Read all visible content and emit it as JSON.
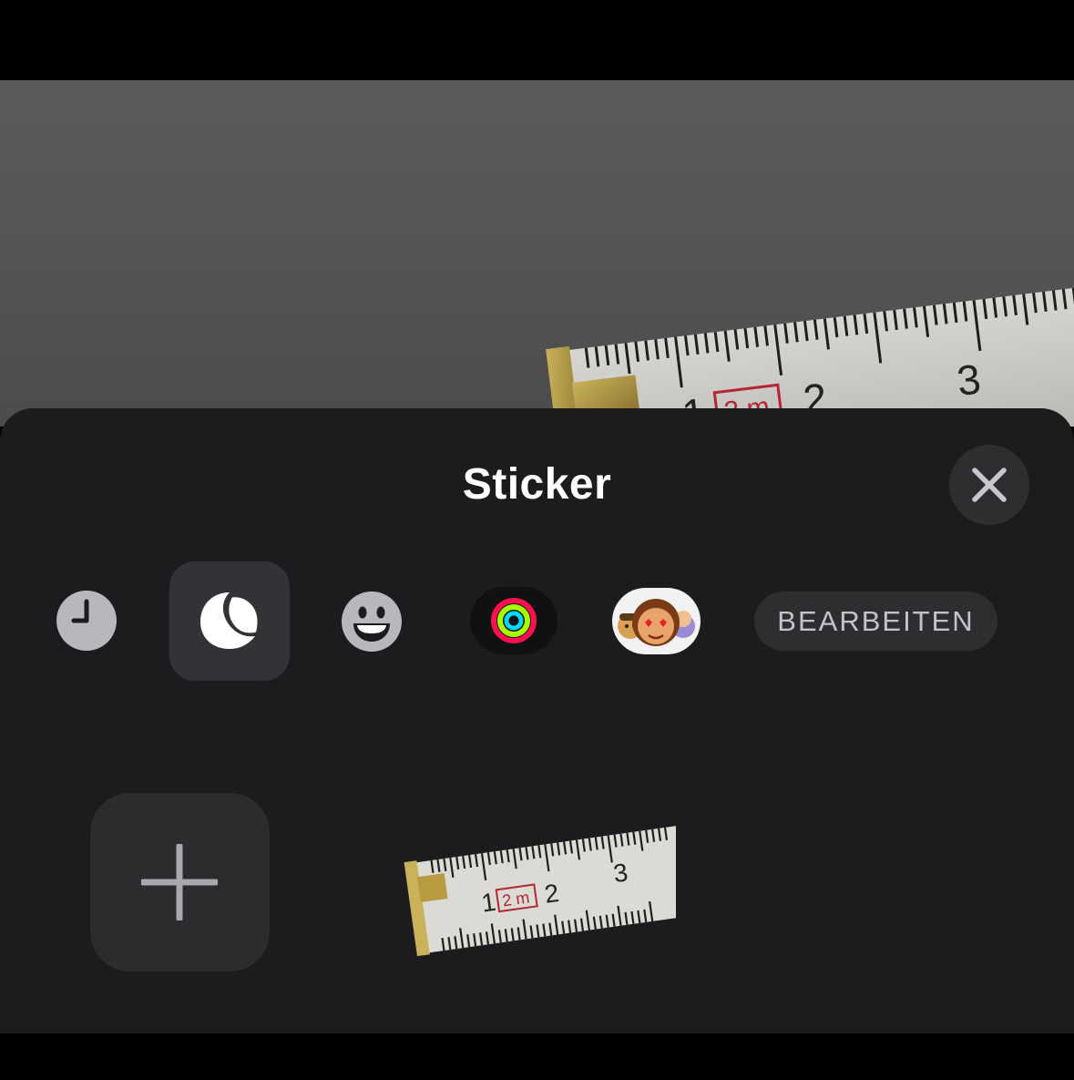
{
  "sheet": {
    "title": "Sticker",
    "close_icon": "xmark-icon"
  },
  "photo_ruler": {
    "numbers": [
      "1",
      "2",
      "3"
    ],
    "badge": "2 m"
  },
  "tabs": [
    {
      "id": "recent",
      "icon": "clock-icon",
      "selected": false
    },
    {
      "id": "stickers",
      "icon": "sticker-peel-icon",
      "selected": true
    },
    {
      "id": "emoji",
      "icon": "smiley-face-icon",
      "selected": false
    },
    {
      "id": "activity",
      "icon": "activity-rings-icon",
      "selected": false
    },
    {
      "id": "memoji",
      "icon": "memoji-faces-icon",
      "selected": false
    }
  ],
  "edit_button": {
    "label": "BEARBEITEN"
  },
  "sticker_grid": {
    "add_icon": "plus-icon",
    "items": [
      {
        "subject": "folding-ruler-sticker",
        "numbers": [
          "1",
          "2",
          "3"
        ],
        "badge": "2 m"
      }
    ]
  },
  "colors": {
    "sheet_bg": "#1c1c1e",
    "button_bg": "#2e2e31",
    "selected_tab_bg": "#333337",
    "ring_move": "#fa114f",
    "ring_exercise": "#a6ff00",
    "ring_stand": "#00d8fe"
  }
}
